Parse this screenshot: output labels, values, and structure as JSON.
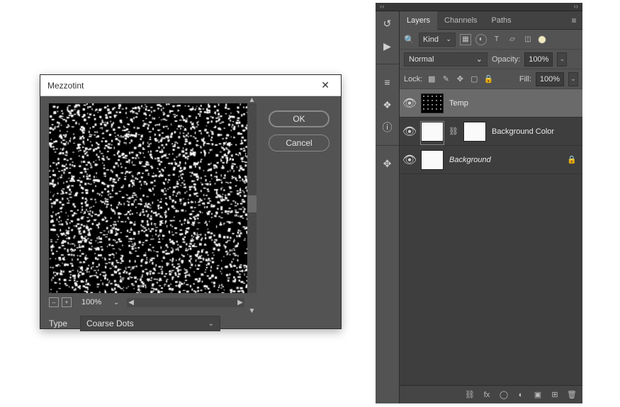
{
  "dialog": {
    "title": "Mezzotint",
    "ok_label": "OK",
    "cancel_label": "Cancel",
    "zoom": "100%",
    "type_label": "Type",
    "type_value": "Coarse Dots"
  },
  "panel": {
    "collapse_left": "‹‹",
    "collapse_right": "››",
    "tabs": {
      "layers": "Layers",
      "channels": "Channels",
      "paths": "Paths"
    },
    "filter": {
      "kind": "Kind"
    },
    "blend": {
      "mode": "Normal",
      "opacity_label": "Opacity:",
      "opacity_value": "100%"
    },
    "lock": {
      "label": "Lock:",
      "fill_label": "Fill:",
      "fill_value": "100%"
    },
    "layers": [
      {
        "name": "Temp"
      },
      {
        "name": "Background Color"
      },
      {
        "name": "Background"
      }
    ]
  }
}
